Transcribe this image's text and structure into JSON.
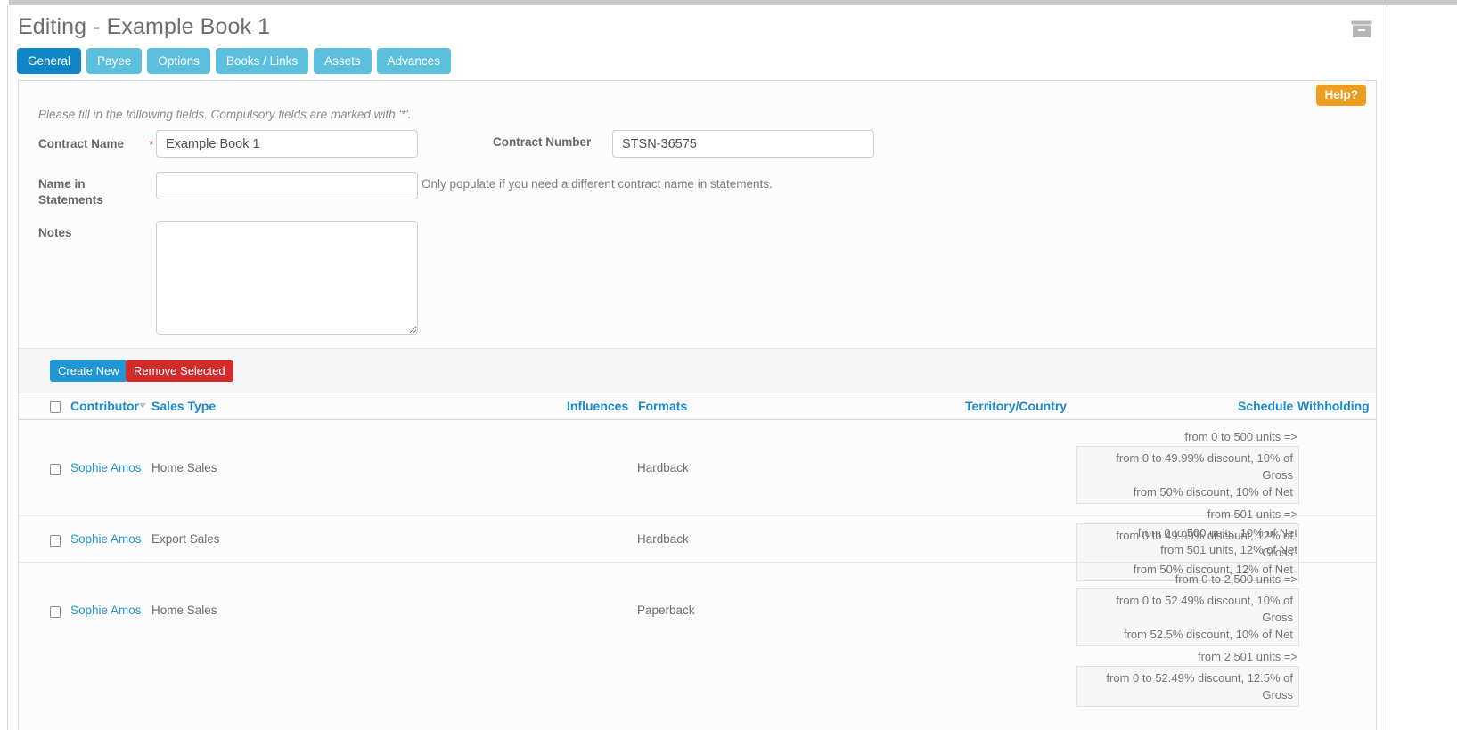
{
  "header": {
    "title": "Editing - Example Book 1",
    "archive_icon": "archive-box-icon"
  },
  "tabs": [
    {
      "label": "General",
      "active": true
    },
    {
      "label": "Payee",
      "active": false
    },
    {
      "label": "Options",
      "active": false
    },
    {
      "label": "Books / Links",
      "active": false
    },
    {
      "label": "Assets",
      "active": false
    },
    {
      "label": "Advances",
      "active": false
    }
  ],
  "help": {
    "label": "Help?"
  },
  "form": {
    "intro": "Please fill in the following fields. Compulsory fields are marked with '*'.",
    "required_marker": "*",
    "fields": {
      "contract_name": {
        "label": "Contract Name",
        "value": "Example Book 1",
        "placeholder": ""
      },
      "contract_number": {
        "label": "Contract Number",
        "value": "STSN-36575",
        "placeholder": ""
      },
      "name_in_statements": {
        "label": "Name in Statements",
        "value": "",
        "placeholder": "",
        "hint": "Only populate if you need a different contract name in statements."
      },
      "notes": {
        "label": "Notes",
        "value": "",
        "placeholder": ""
      }
    }
  },
  "toolbar": {
    "create_new_label": "Create New",
    "remove_selected_label": "Remove Selected"
  },
  "table": {
    "columns": [
      "Contributor",
      "Sales Type",
      "Influences",
      "Formats",
      "Territory/Country",
      "Schedule",
      "Withholding"
    ],
    "sort": {
      "column": "Contributor",
      "direction": "desc"
    },
    "select_all_checked": false,
    "rows": [
      {
        "selected": false,
        "contributor": "Sophie Amos",
        "sales_type": "Home Sales",
        "influences": "",
        "formats": "Hardback",
        "territory": "",
        "withholding": "",
        "schedule": [
          {
            "type": "text",
            "text": "from 0 to 500 units =>"
          },
          {
            "type": "box",
            "lines": [
              "from 0 to 49.99% discount, 10% of Gross",
              "from 50% discount, 10% of Net"
            ]
          },
          {
            "type": "text",
            "text": "from 501 units =>"
          },
          {
            "type": "box",
            "lines": [
              "from 0 to 49.99% discount, 12% of Gross",
              "from 50% discount, 12% of Net"
            ]
          }
        ]
      },
      {
        "selected": false,
        "contributor": "Sophie Amos",
        "sales_type": "Export Sales",
        "influences": "",
        "formats": "Hardback",
        "territory": "",
        "withholding": "",
        "schedule": [
          {
            "type": "text",
            "text": "from 0 to 500 units, 10% of Net"
          },
          {
            "type": "text",
            "text": "from 501 units, 12% of Net"
          }
        ]
      },
      {
        "selected": false,
        "contributor": "Sophie Amos",
        "sales_type": "Home Sales",
        "influences": "",
        "formats": "Paperback",
        "territory": "",
        "withholding": "",
        "schedule": [
          {
            "type": "text",
            "text": "from 0 to 2,500 units =>"
          },
          {
            "type": "box",
            "lines": [
              "from 0 to 52.49% discount, 10% of Gross",
              "from 52.5% discount, 10% of Net"
            ]
          },
          {
            "type": "text",
            "text": "from 2,501 units =>"
          },
          {
            "type": "box",
            "lines": [
              "from 0 to 52.49% discount, 12.5% of Gross"
            ]
          }
        ]
      }
    ]
  },
  "colors": {
    "tab_active": "#0e86c8",
    "tab_inactive": "#5bc0de",
    "link": "#2196d6",
    "help": "#ef9d1f",
    "danger": "#d22b2b",
    "required": "#d9534f"
  }
}
